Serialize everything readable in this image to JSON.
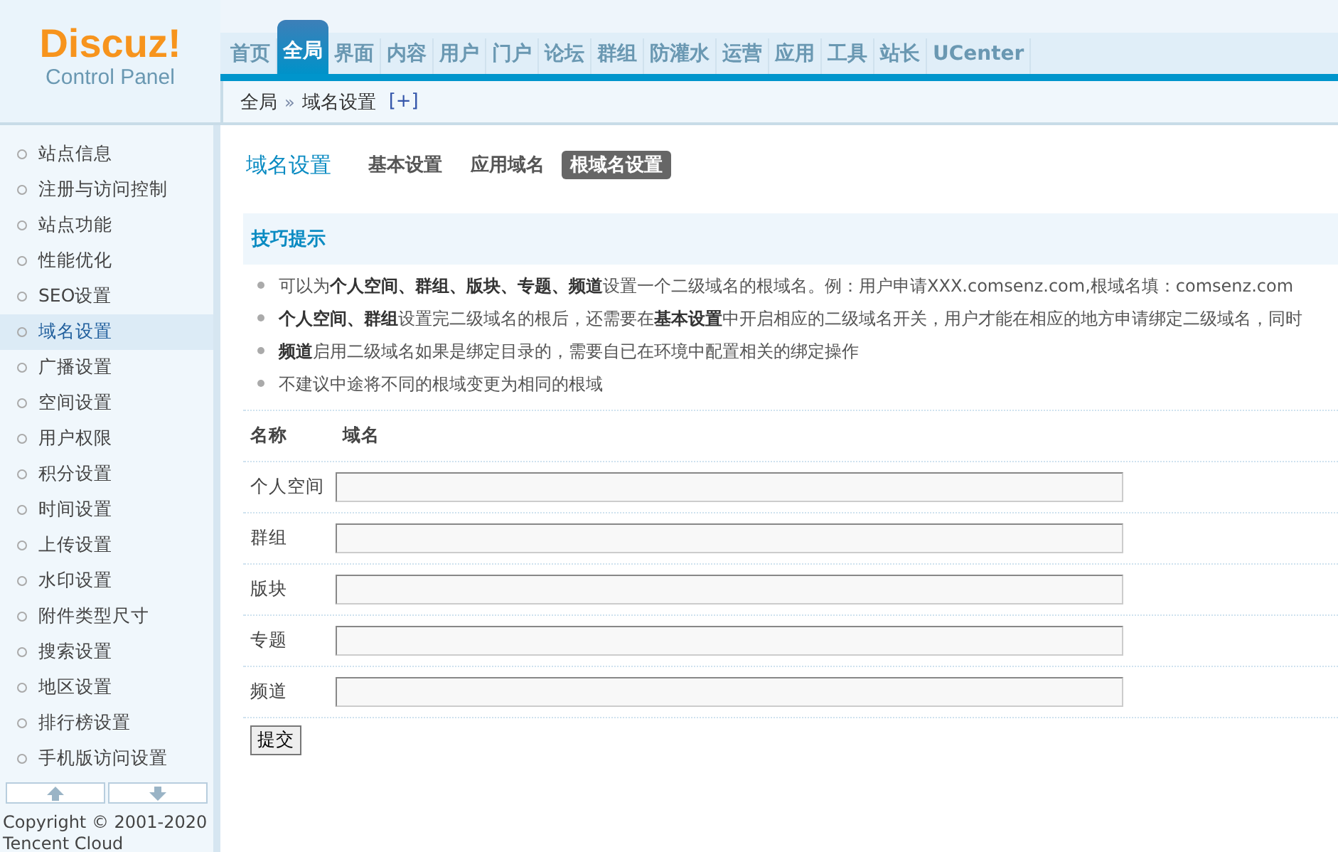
{
  "logo": {
    "brand": "Discuz!",
    "subtitle": "Control Panel"
  },
  "nav": [
    {
      "label": "首页",
      "selected": false
    },
    {
      "label": "全局",
      "selected": true
    },
    {
      "label": "界面",
      "selected": false
    },
    {
      "label": "内容",
      "selected": false
    },
    {
      "label": "用户",
      "selected": false
    },
    {
      "label": "门户",
      "selected": false
    },
    {
      "label": "论坛",
      "selected": false
    },
    {
      "label": "群组",
      "selected": false
    },
    {
      "label": "防灌水",
      "selected": false
    },
    {
      "label": "运营",
      "selected": false
    },
    {
      "label": "应用",
      "selected": false
    },
    {
      "label": "工具",
      "selected": false
    },
    {
      "label": "站长",
      "selected": false
    },
    {
      "label": "UCenter",
      "selected": false
    }
  ],
  "breadcrumb": {
    "items": [
      "全局",
      "域名设置"
    ],
    "separator": "»",
    "add": "[+]"
  },
  "sidebar": {
    "items": [
      {
        "label": "站点信息",
        "selected": false
      },
      {
        "label": "注册与访问控制",
        "selected": false
      },
      {
        "label": "站点功能",
        "selected": false
      },
      {
        "label": "性能优化",
        "selected": false
      },
      {
        "label": "SEO设置",
        "selected": false
      },
      {
        "label": "域名设置",
        "selected": true
      },
      {
        "label": "广播设置",
        "selected": false
      },
      {
        "label": "空间设置",
        "selected": false
      },
      {
        "label": "用户权限",
        "selected": false
      },
      {
        "label": "积分设置",
        "selected": false
      },
      {
        "label": "时间设置",
        "selected": false
      },
      {
        "label": "上传设置",
        "selected": false
      },
      {
        "label": "水印设置",
        "selected": false
      },
      {
        "label": "附件类型尺寸",
        "selected": false
      },
      {
        "label": "搜索设置",
        "selected": false
      },
      {
        "label": "地区设置",
        "selected": false
      },
      {
        "label": "排行榜设置",
        "selected": false
      },
      {
        "label": "手机版访问设置",
        "selected": false
      }
    ],
    "copyright": [
      "Copyright © 2001-2020",
      "Tencent Cloud"
    ]
  },
  "page": {
    "title": "域名设置",
    "tabs": [
      {
        "label": "基本设置",
        "selected": false
      },
      {
        "label": "应用域名",
        "selected": false
      },
      {
        "label": "根域名设置",
        "selected": true
      }
    ]
  },
  "tips": {
    "title": "技巧提示",
    "items": [
      "可以为**个人空间、群组、版块、专题、频道**设置一个二级域名的根域名。例：用户申请XXX.comsenz.com,根域名填：comsenz.com",
      "**个人空间、群组**设置完二级域名的根后，还需要在**基本设置**中开启相应的二级域名开关，用户才能在相应的地方申请绑定二级域名，同时",
      "**频道**启用二级域名如果是绑定目录的，需要自已在环境中配置相关的绑定操作",
      "不建议中途将不同的根域变更为相同的根域"
    ]
  },
  "table": {
    "columns": [
      "名称",
      "域名"
    ],
    "rows": [
      {
        "name": "个人空间"
      },
      {
        "name": "群组"
      },
      {
        "name": "版块"
      },
      {
        "name": "专题"
      },
      {
        "name": "频道"
      }
    ]
  },
  "submit": "提交"
}
